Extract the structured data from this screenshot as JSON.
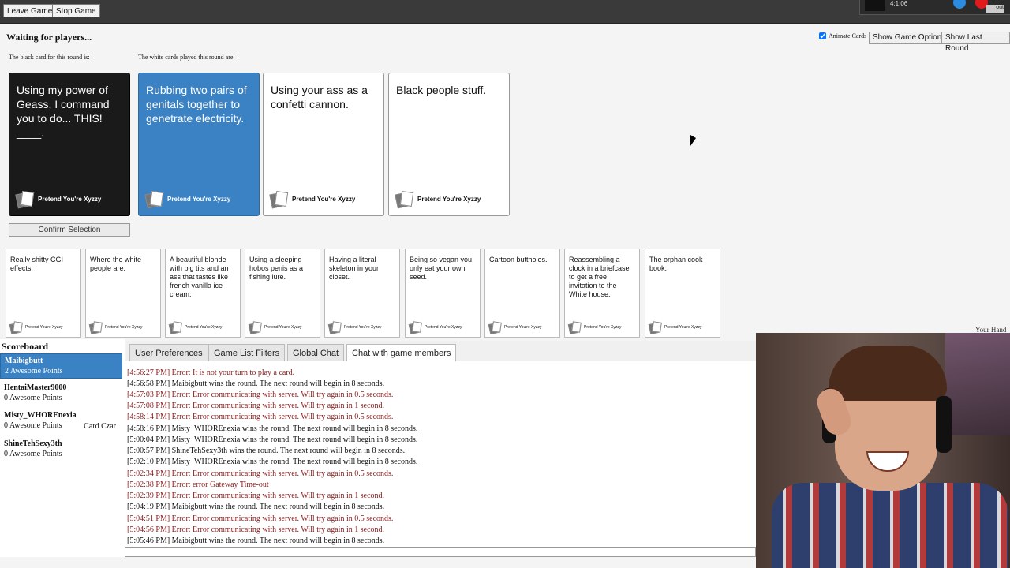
{
  "topbar": {
    "leave_label": "Leave Game",
    "stop_label": "Stop Game",
    "profile_text": "4:1:06",
    "logout_label": "out"
  },
  "status": {
    "waiting": "Waiting for players...",
    "black_label": "The black card for this round is:",
    "white_label": "The white cards played this round are:"
  },
  "options": {
    "animate_label": "Animate Cards",
    "show_options_label": "Show Game Options",
    "show_last_round_label": "Show Last Round"
  },
  "black_card": {
    "text": "Using my power of Geass, I command you to do... THIS! ____.",
    "footer": "Pretend You're Xyzzy"
  },
  "played_cards": [
    {
      "text": "Rubbing two pairs of genitals together to genetrate electricity.",
      "footer": "Pretend You're Xyzzy"
    },
    {
      "text": "Using your ass as a confetti cannon.",
      "footer": "Pretend You're Xyzzy"
    },
    {
      "text": "Black people stuff.",
      "footer": "Pretend You're Xyzzy"
    }
  ],
  "confirm_label": "Confirm Selection",
  "hand": [
    {
      "text": "Really shitty CGI effects.",
      "footer": "Pretend You're Xyzzy"
    },
    {
      "text": "Where the white people are.",
      "footer": "Pretend You're Xyzzy"
    },
    {
      "text": "A beautiful blonde with big tits and an ass that tastes like french vanilla ice cream.",
      "footer": "Pretend You're Xyzzy"
    },
    {
      "text": "Using a sleeping hobos penis as a fishing lure.",
      "footer": "Pretend You're Xyzzy"
    },
    {
      "text": "Having a literal skeleton in your closet.",
      "footer": "Pretend You're Xyzzy"
    },
    {
      "text": "Being so vegan you only eat your own seed.",
      "footer": "Pretend You're Xyzzy"
    },
    {
      "text": "Cartoon buttholes.",
      "footer": "Pretend You're Xyzzy"
    },
    {
      "text": "Reassembling a clock in a briefcase to get a free invitation to the White house.",
      "footer": "Pretend You're Xyzzy"
    },
    {
      "text": "The orphan cook book.",
      "footer": "Pretend You're Xyzzy"
    }
  ],
  "your_hand_label": "Your Hand",
  "scoreboard": {
    "title": "Scoreboard",
    "players": [
      {
        "name": "Maibigbutt",
        "points": "2 Awesome Points",
        "status": ""
      },
      {
        "name": "HentaiMaster9000",
        "points": "0 Awesome Points",
        "status": ""
      },
      {
        "name": "Misty_WHOREnexia",
        "points": "0 Awesome Points",
        "status": "Card Czar"
      },
      {
        "name": "ShineTehSexy3th",
        "points": "0 Awesome Points",
        "status": ""
      }
    ]
  },
  "tabs": [
    "User Preferences",
    "Game List Filters",
    "Global Chat",
    "Chat with game members"
  ],
  "chat": [
    {
      "text": "[4:56:27 PM] Error: It is not your turn to play a card.",
      "error": true
    },
    {
      "text": "[4:56:58 PM] Maibigbutt wins the round. The next round will begin in 8 seconds.",
      "error": false
    },
    {
      "text": "[4:57:03 PM] Error: Error communicating with server. Will try again in 0.5 seconds.",
      "error": true
    },
    {
      "text": "[4:57:08 PM] Error: Error communicating with server. Will try again in 1 second.",
      "error": true
    },
    {
      "text": "[4:58:14 PM] Error: Error communicating with server. Will try again in 0.5 seconds.",
      "error": true
    },
    {
      "text": "[4:58:16 PM] Misty_WHOREnexia wins the round. The next round will begin in 8 seconds.",
      "error": false
    },
    {
      "text": "[5:00:04 PM] Misty_WHOREnexia wins the round. The next round will begin in 8 seconds.",
      "error": false
    },
    {
      "text": "[5:00:57 PM] ShineTehSexy3th wins the round. The next round will begin in 8 seconds.",
      "error": false
    },
    {
      "text": "[5:02:10 PM] Misty_WHOREnexia wins the round. The next round will begin in 8 seconds.",
      "error": false
    },
    {
      "text": "[5:02:34 PM] Error: Error communicating with server. Will try again in 0.5 seconds.",
      "error": true
    },
    {
      "text": "[5:02:38 PM] Error: error Gateway Time-out",
      "error": true
    },
    {
      "text": "[5:02:39 PM] Error: Error communicating with server. Will try again in 1 second.",
      "error": true
    },
    {
      "text": "[5:04:19 PM] Maibigbutt wins the round. The next round will begin in 8 seconds.",
      "error": false
    },
    {
      "text": "[5:04:51 PM] Error: Error communicating with server. Will try again in 0.5 seconds.",
      "error": true
    },
    {
      "text": "[5:04:56 PM] Error: Error communicating with server. Will try again in 1 second.",
      "error": true
    },
    {
      "text": "[5:05:46 PM] Maibigbutt wins the round. The next round will begin in 8 seconds.",
      "error": false
    }
  ]
}
